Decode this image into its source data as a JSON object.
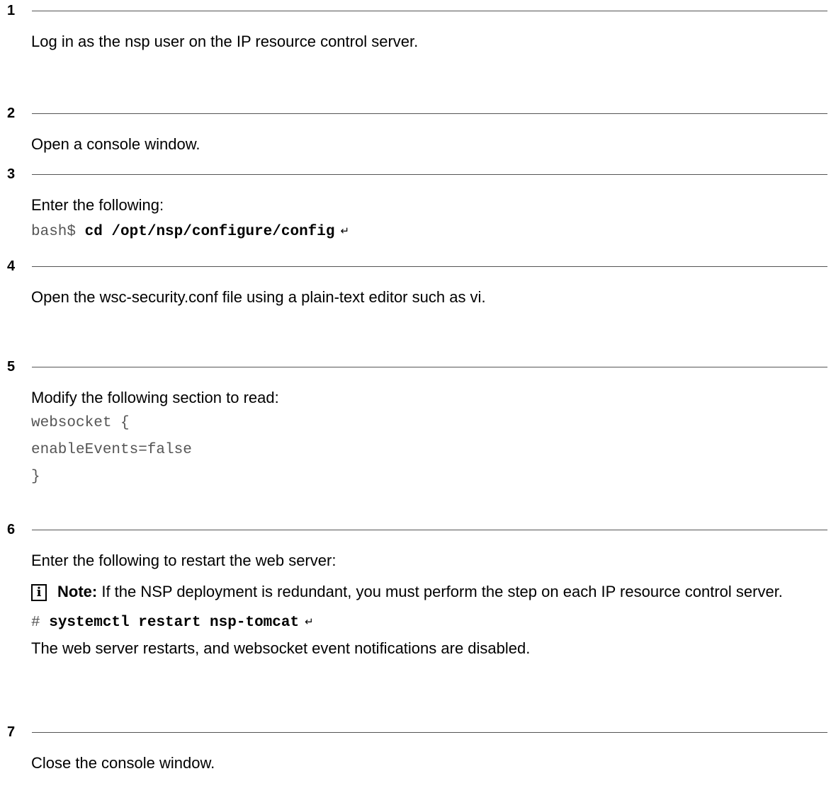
{
  "steps": [
    {
      "number": "1",
      "text": "Log in as the nsp user on the IP resource control server."
    },
    {
      "number": "2",
      "text": "Open a console window."
    },
    {
      "number": "3",
      "text": "Enter the following:",
      "command": {
        "prompt": "bash$ ",
        "cmd": "cd /opt/nsp/configure/config",
        "enter_symbol": "↵"
      }
    },
    {
      "number": "4",
      "text": "Open the wsc-security.conf file using a plain-text editor such as vi."
    },
    {
      "number": "5",
      "text": "Modify the following section to read:",
      "code_lines": [
        "websocket {",
        "enableEvents=false",
        "}"
      ]
    },
    {
      "number": "6",
      "text": "Enter the following to restart the web server:",
      "note": {
        "icon": "info-icon",
        "icon_glyph": "i",
        "label": "Note:",
        "text": " If the NSP deployment is redundant, you must perform the step on each IP resource control server."
      },
      "command": {
        "prompt": "# ",
        "cmd": "systemctl restart nsp-tomcat",
        "enter_symbol": "↵"
      },
      "result": "The web server restarts, and websocket event notifications are disabled."
    },
    {
      "number": "7",
      "text": "Close the console window."
    }
  ]
}
